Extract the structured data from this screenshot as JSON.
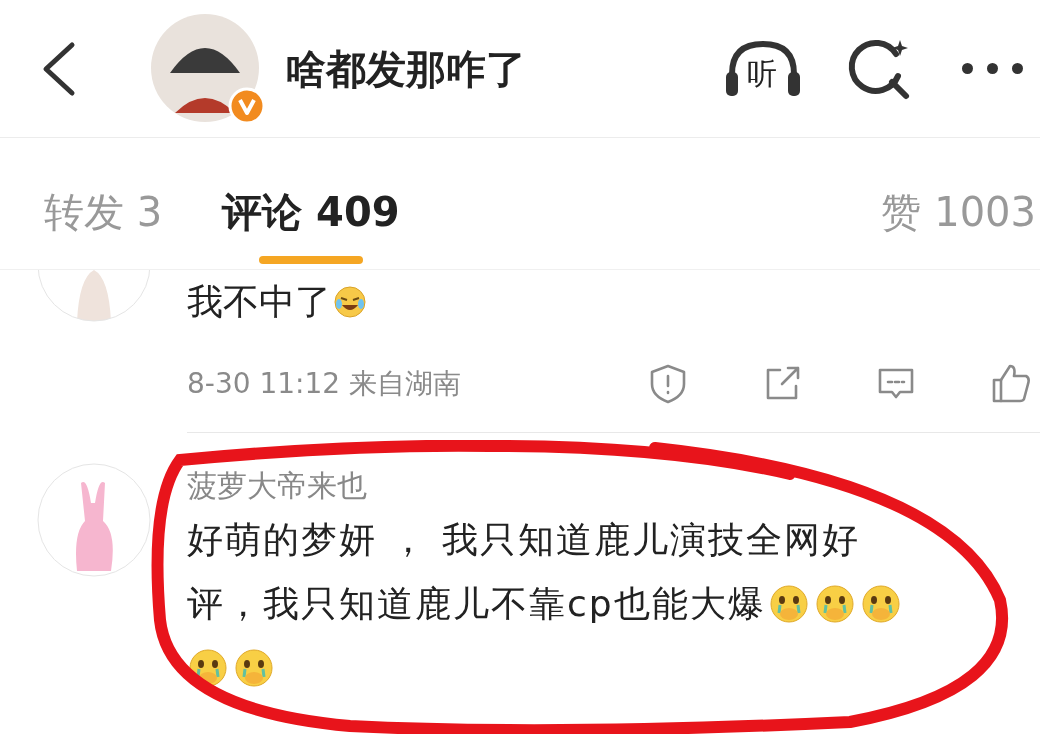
{
  "header": {
    "title": "啥都发那咋了",
    "verified": true,
    "listen_label": "听"
  },
  "tabs": [
    {
      "label": "转发 3",
      "selected": false
    },
    {
      "label": "评论 409",
      "selected": true
    }
  ],
  "likes_tab": {
    "label": "赞 1003"
  },
  "comments": [
    {
      "lines": [
        {
          "text": "我不中了",
          "emojis": [
            {
              "kind": "laughing"
            }
          ]
        }
      ],
      "meta": "8-30 11:12 来自湖南"
    },
    {
      "username": "菠萝大帝来也",
      "lines": [
        {
          "text": "好萌的梦妍 ， 我只知道鹿儿演技全网好"
        },
        {
          "text": "评，我只知道鹿儿不靠cp也能大爆",
          "emojis": [
            {
              "kind": "crying"
            },
            {
              "kind": "crying"
            },
            {
              "kind": "crying"
            }
          ]
        },
        {
          "emojis": [
            {
              "kind": "crying"
            },
            {
              "kind": "crying"
            }
          ]
        }
      ]
    }
  ],
  "annotation": {
    "kind": "circle"
  }
}
